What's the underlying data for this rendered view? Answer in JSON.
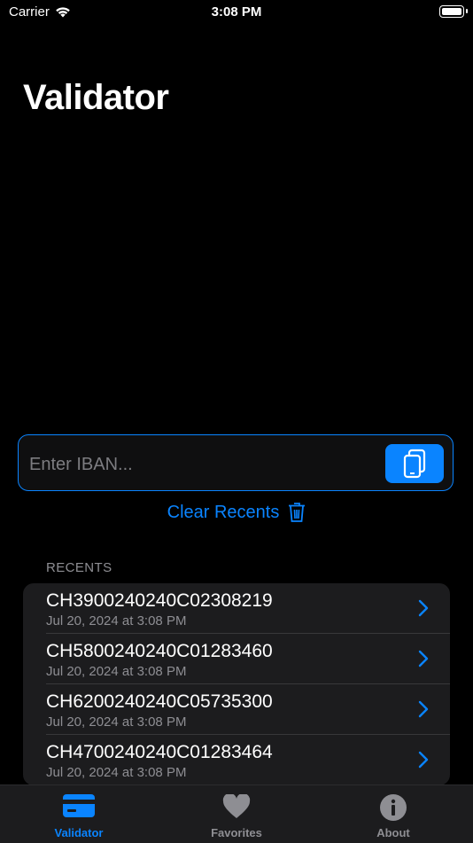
{
  "status": {
    "carrier": "Carrier",
    "time": "3:08 PM"
  },
  "title": "Validator",
  "input": {
    "placeholder": "Enter IBAN..."
  },
  "clear_label": "Clear Recents",
  "recents_header": "RECENTS",
  "recents": [
    {
      "iban": "CH3900240240C02308219",
      "date": "Jul 20, 2024 at 3:08 PM"
    },
    {
      "iban": "CH5800240240C01283460",
      "date": "Jul 20, 2024 at 3:08 PM"
    },
    {
      "iban": "CH6200240240C05735300",
      "date": "Jul 20, 2024 at 3:08 PM"
    },
    {
      "iban": "CH4700240240C01283464",
      "date": "Jul 20, 2024 at 3:08 PM"
    }
  ],
  "tabs": [
    {
      "label": "Validator",
      "icon": "credit-card-icon",
      "active": true
    },
    {
      "label": "Favorites",
      "icon": "heart-icon",
      "active": false
    },
    {
      "label": "About",
      "icon": "info-icon",
      "active": false
    }
  ],
  "colors": {
    "accent": "#0a84ff",
    "background": "#000000",
    "cell": "#1c1c1e",
    "secondary_text": "#8e8e93"
  }
}
